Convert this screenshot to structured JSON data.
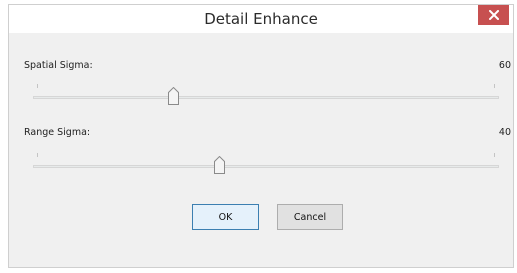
{
  "window": {
    "title": "Detail Enhance",
    "close_icon": "close-icon",
    "close_color": "#c75050"
  },
  "spatial_sigma": {
    "label": "Spatial Sigma:",
    "value": "60",
    "level": 0.3
  },
  "range_sigma": {
    "label": "Range Sigma:",
    "value": "40",
    "level": 0.4
  },
  "buttons": {
    "ok_label": "OK",
    "cancel_label": "Cancel"
  }
}
